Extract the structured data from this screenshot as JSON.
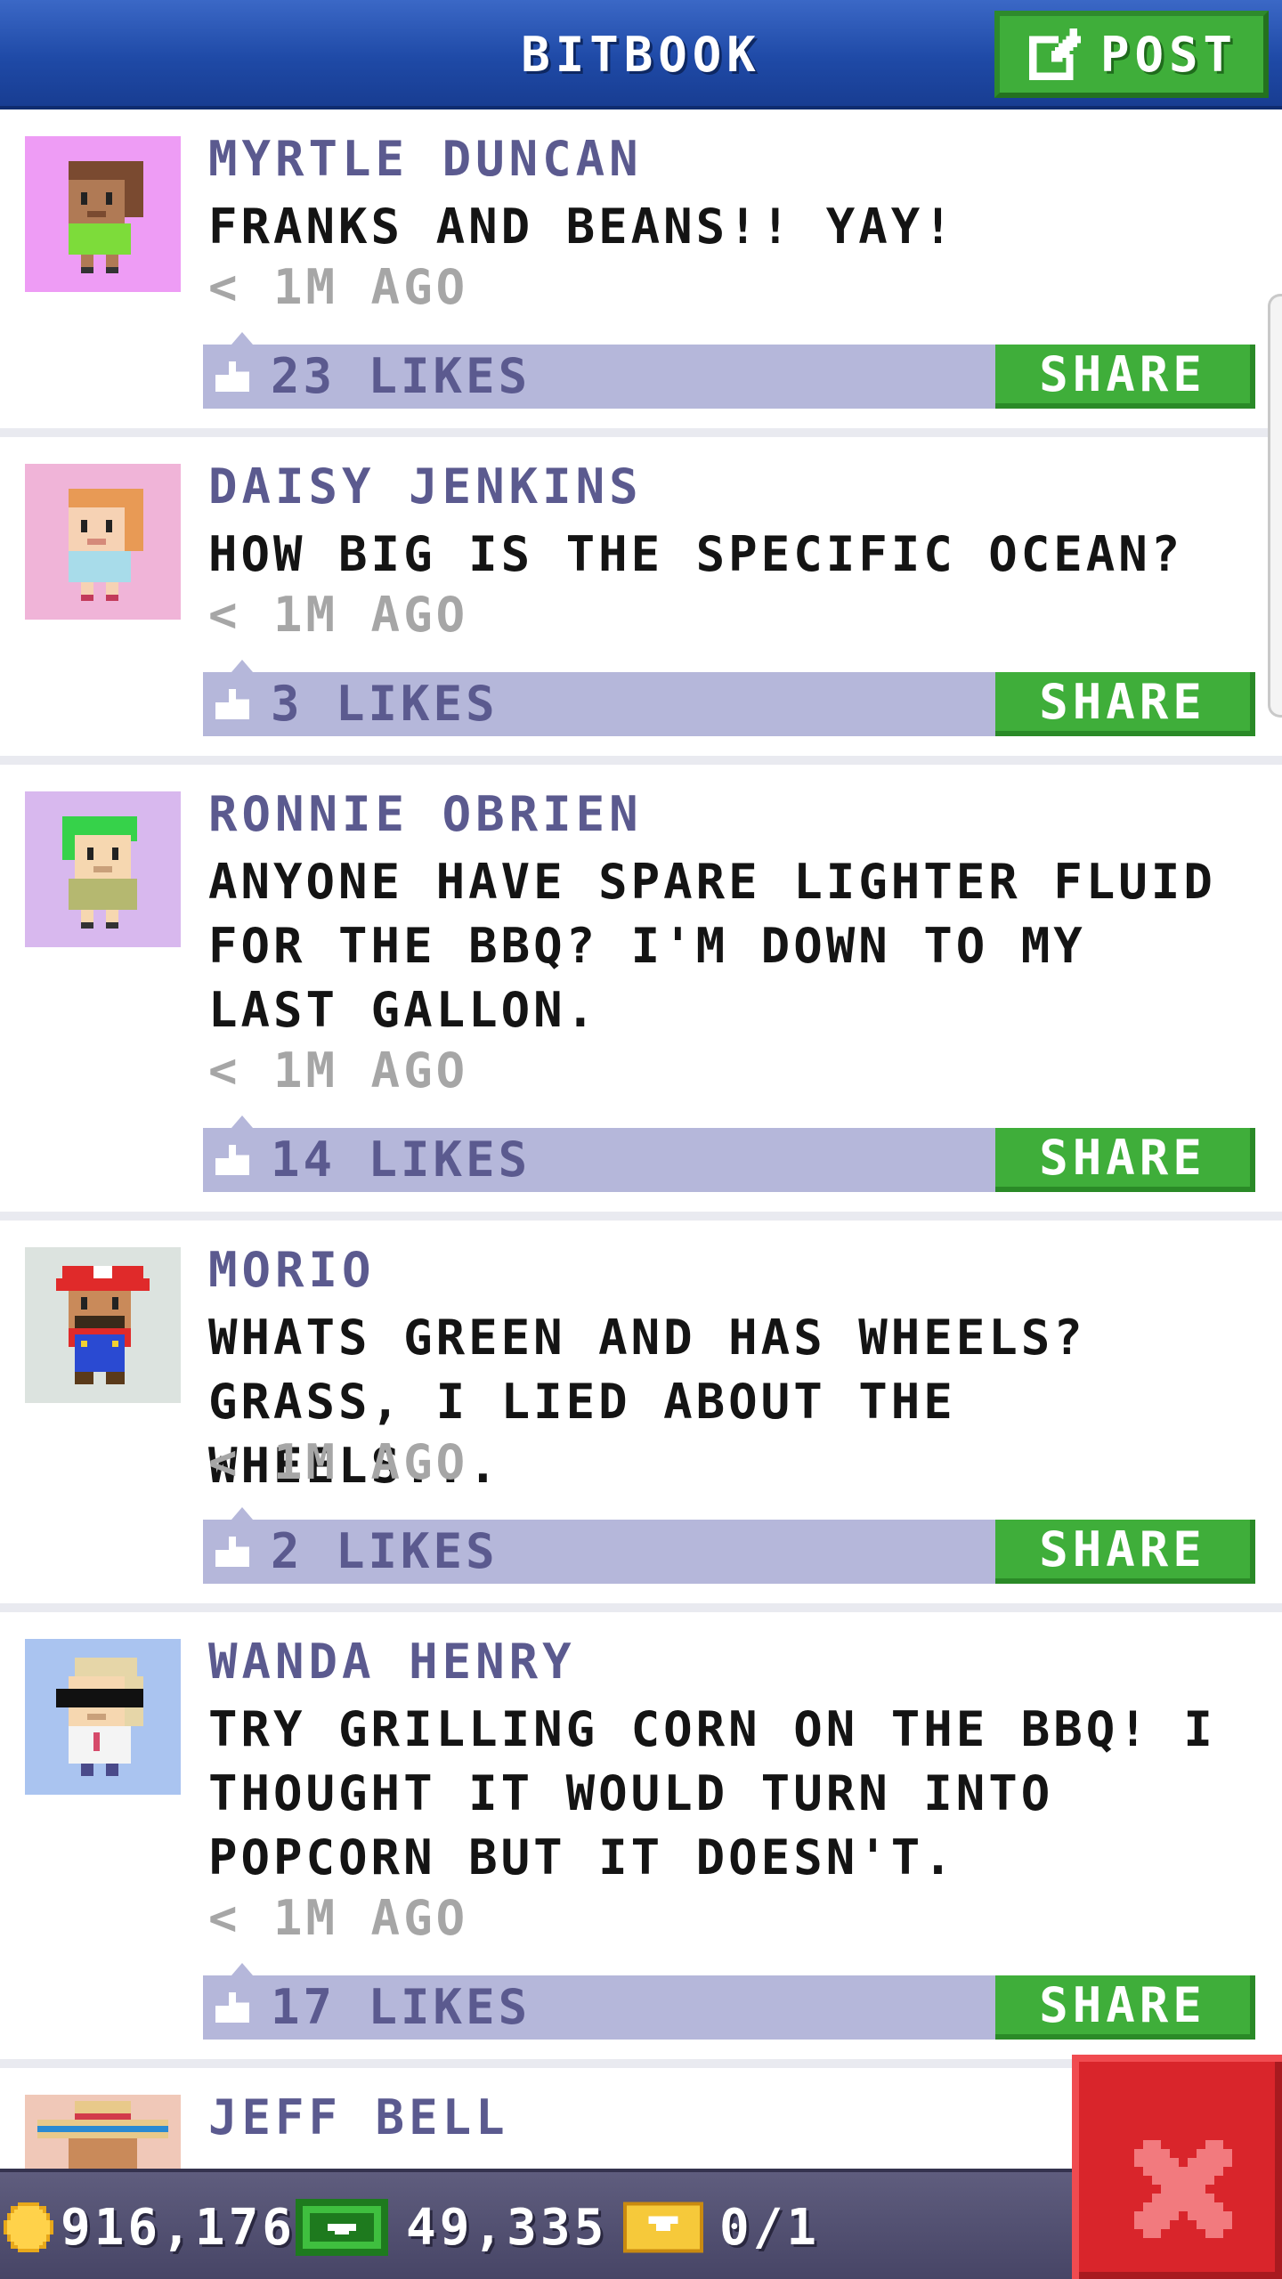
{
  "header": {
    "title": "BITBOOK",
    "post_label": "POST"
  },
  "posts": [
    {
      "name": "MYRTLE DUNCAN",
      "message": "FRANKS AND BEANS!! YAY!",
      "time": "< 1M AGO",
      "likes": "23 LIKES",
      "share_label": "SHARE",
      "avatar_bg": "#ee9cf5"
    },
    {
      "name": "DAISY JENKINS",
      "message": "HOW BIG IS THE SPECIFIC OCEAN?",
      "time": "< 1M AGO",
      "likes": "3 LIKES",
      "share_label": "SHARE",
      "avatar_bg": "#f0b4d8"
    },
    {
      "name": "RONNIE OBRIEN",
      "message": "ANYONE HAVE SPARE LIGHTER FLUID FOR THE BBQ? I'M DOWN TO MY LAST GALLON.",
      "time": "< 1M AGO",
      "likes": "14 LIKES",
      "share_label": "SHARE",
      "avatar_bg": "#d8b8ee"
    },
    {
      "name": "MORIO",
      "message": "WHATS GREEN AND HAS WHEELS? GRASS, I LIED ABOUT THE WHEELS...",
      "time": "< 1M AGO",
      "likes": "2 LIKES",
      "share_label": "SHARE",
      "avatar_bg": "#dce3df"
    },
    {
      "name": "WANDA HENRY",
      "message": "TRY GRILLING CORN ON THE BBQ! I THOUGHT IT WOULD TURN INTO POPCORN BUT IT DOESN'T.",
      "time": "< 1M AGO",
      "likes": "17 LIKES",
      "share_label": "SHARE",
      "avatar_bg": "#aac4f0"
    },
    {
      "name": "JEFF BELL",
      "avatar_bg": "#f0c8b8"
    }
  ],
  "status_bar": {
    "coins": "916,176",
    "bux": "49,335",
    "tickets": "0/1"
  },
  "icons": {
    "post": "edit-icon",
    "like": "thumbs-up-icon",
    "coin": "coin-icon",
    "cash": "cash-icon",
    "ticket": "ticket-icon",
    "close": "close-icon"
  },
  "colors": {
    "header_blue": "#1f4aa7",
    "accent_green": "#3fae3a",
    "like_bar": "#b5b7da",
    "name_purple": "#5b5a8f",
    "close_red": "#d9252b"
  }
}
